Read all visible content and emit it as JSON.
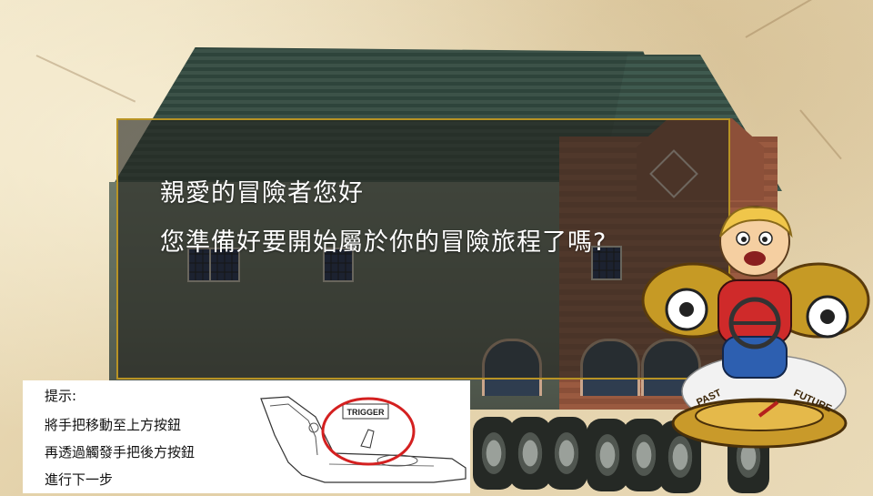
{
  "dialog": {
    "line1": "親愛的冒險者您好",
    "line2": "您準備好要開始屬於你的冒險旅程了嗎?"
  },
  "hint": {
    "title": "提示:",
    "step1": "將手把移動至上方按鈕",
    "step2": "再透過觸發手把後方按鈕",
    "step3": "進行下一步",
    "trigger_label": "TRIGGER"
  },
  "time_machine": {
    "past_label": "PAST",
    "future_label": "FUTURE"
  },
  "colors": {
    "dialog_border": "#b89324",
    "trigger_circle": "#d42020"
  }
}
